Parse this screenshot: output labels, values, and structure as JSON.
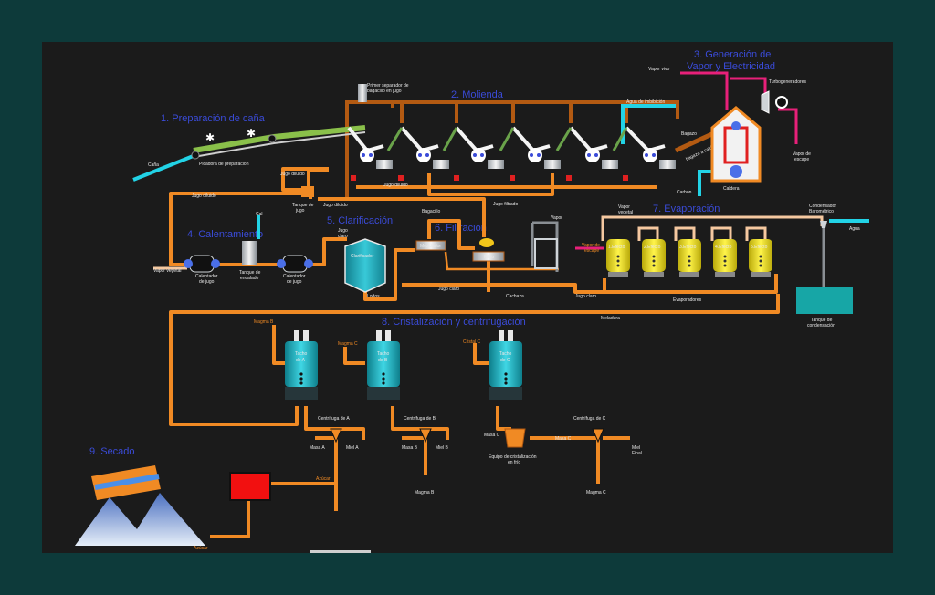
{
  "sections": {
    "s1": "1. Preparación de caña",
    "s2": "2. Molienda",
    "s3_line1": "3. Generación de",
    "s3_line2": "Vapor y Electricidad",
    "s4": "4. Calentamiento",
    "s5": "5. Clarificación",
    "s6": "6. Filtración",
    "s7": "7. Evaporación",
    "s8": "8. Cristalización y centrifugación",
    "s9": "9. Secado"
  },
  "labels": {
    "cana": "Caña",
    "picadora": "Picadora de preparación",
    "primer_line1": "Primer separador de",
    "primer_line2": "bagacillo en jugo",
    "jugo_diluido_1": "Jugo diluido",
    "jugo_diluido_2": "Jugo diluido",
    "jugo_diluido_3": "Jugo diluido",
    "jugo_diluido_4": "Jugo diluido",
    "tanque_jugo_1": "Tanque de",
    "tanque_jugo_2": "jugo",
    "agua_imbibicion": "Agua de imbibición",
    "bagazo": "Bagazo",
    "bagazo_a_caldera": "bagazo a caldera",
    "caldera": "Caldera",
    "carbon": "Carbón",
    "vapor_vivo": "Vapor vivo",
    "turbogeneradores": "Turbogeneradores",
    "vapor_escape_1": "Vapor de",
    "vapor_escape_2": "escape",
    "jugo_filtrado": "Jugo filtrado",
    "cal": "Cal",
    "vapor_vegetal": "Vapor vegetal",
    "calentador_1a": "Calentador",
    "calentador_1b": "de jugo",
    "tanque_encalado_1": "Tanque de",
    "tanque_encalado_2": "encalado",
    "calentador_2a": "Calentador",
    "calentador_2b": "de jugo",
    "jugo_claro_top": "Jugo",
    "jugo_claro_top2": "claro",
    "clarificador": "Clarificador",
    "lodos": "Lodos",
    "bagacillo": "Bagacillo",
    "mezclador": "Mezclador",
    "filtro": "Filtro",
    "cachaza": "Cachaza",
    "jugo_claro": "Jugo claro",
    "jugo_claro_2": "Jugo claro",
    "vapor": "Vapor",
    "vapor_vegetal_top": "Vapor",
    "vapor_vegetal_top2": "vegetal",
    "vapor_escape_side1": "Vapor de",
    "vapor_escape_side2": "escape",
    "efecto1": "1.Efecto",
    "efecto2": "2.Efecto",
    "efecto3": "3.Efecto",
    "efecto4": "4.Efecto",
    "efecto5": "5.Efecto",
    "evaporadores": "Evaporadores",
    "meladura": "Meladura",
    "condensador_1": "Condensador",
    "condensador_2": "Barométrico",
    "tanque_cond_1": "Tanque de",
    "tanque_cond_2": "condensación",
    "agua": "Agua",
    "magma_b": "Magma B",
    "magma_c": "Magma C",
    "cristal_c": "Cristal C",
    "tacho_a_1": "Tacho",
    "tacho_a_2": "de A",
    "tacho_b_1": "Tacho",
    "tacho_b_2": "de B",
    "tacho_c_1": "Tacho",
    "tacho_c_2": "de C",
    "centrifuga_a": "Centrífuga de A",
    "centrifuga_b": "Centrífuga de B",
    "centrifuga_c": "Centrífuga de C",
    "masa_a": "Masa A",
    "miel_a": "Miel A",
    "masa_b": "Masa B",
    "miel_b": "Miel B",
    "masa_c": "Masa C",
    "masa_c_2": "Masa C",
    "equipo_1": "Equipo de cristalización",
    "equipo_2": "en frío",
    "miel_final_1": "Miel",
    "miel_final_2": "Final",
    "magma_b_bottom": "Magma B",
    "magma_c_bottom": "Magma C",
    "azucar_1": "Azúcar",
    "azucar_2": "Azúcar"
  },
  "colors": {
    "background": "#0d3a3a",
    "panel": "#1b1b1b",
    "pipe": "#f08a24",
    "section_title": "#3a4bd8",
    "steam": "#e8207a",
    "water": "#22d3e6",
    "evaporator": "#f2e21a",
    "tacho": "#17b7c8"
  }
}
